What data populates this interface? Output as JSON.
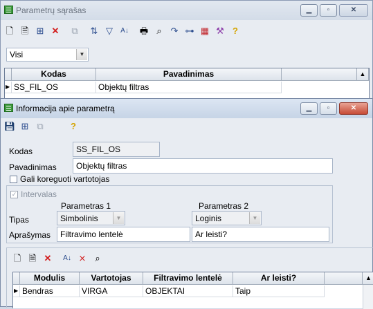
{
  "back_window": {
    "title": "Parametrų sąrašas",
    "filter": {
      "value": "Visi"
    },
    "grid": {
      "columns": [
        "Kodas",
        "Pavadinimas"
      ],
      "rows": [
        {
          "indicator": "▶",
          "kodas": "SS_FIL_OS",
          "pavadinimas": "Objektų filtras"
        }
      ]
    }
  },
  "front_window": {
    "title": "Informacija apie parametrą",
    "form": {
      "kodas_label": "Kodas",
      "kodas_value": "SS_FIL_OS",
      "pavadinimas_label": "Pavadinimas",
      "pavadinimas_value": "Objektų filtras",
      "editable_label": "Gali koreguoti vartotojas",
      "interval_label": "Intervalas",
      "param1_header": "Parametras 1",
      "param2_header": "Parametras 2",
      "tipas_label": "Tipas",
      "tipas1_value": "Simbolinis",
      "tipas2_value": "Loginis",
      "aprasymas_label": "Aprašymas",
      "aprasymas1_value": "Filtravimo lentelė",
      "aprasymas2_value": "Ar leisti?"
    },
    "grid": {
      "columns": [
        "Modulis",
        "Vartotojas",
        "Filtravimo lentelė",
        "Ar leisti?"
      ],
      "rows": [
        {
          "indicator": "▶",
          "modulis": "Bendras",
          "vartotojas": "VIRGA",
          "filtravimo_lentele": "OBJEKTAI",
          "ar_leisti": "Taip"
        }
      ]
    }
  },
  "colors": {
    "title_bar": "#c6d4e6",
    "close_button": "#c74b36",
    "window_bg": "#e8ecf2"
  }
}
